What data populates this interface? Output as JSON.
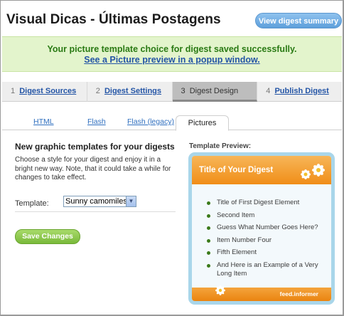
{
  "page": {
    "title": "Visual Dicas - Últimas Postagens",
    "view_digest_button": "View digest summary"
  },
  "banner": {
    "message": "Your picture template choice for digest saved successfully.",
    "link_text": "See a Picture preview in a popup window."
  },
  "steps": [
    {
      "number": "1",
      "label": "Digest Sources"
    },
    {
      "number": "2",
      "label": "Digest Settings"
    },
    {
      "number": "3",
      "label": "Digest Design"
    },
    {
      "number": "4",
      "label": "Publish Digest"
    }
  ],
  "subtabs": [
    {
      "label": "HTML"
    },
    {
      "label": "Flash"
    },
    {
      "label": "Flash (legacy)"
    },
    {
      "label": "Pictures"
    }
  ],
  "main": {
    "heading": "New graphic templates for your digests",
    "description": "Choose a style for your digest and enjoy it in a bright new way. Note, that it could take a while for changes to take effect.",
    "template_label": "Template:",
    "template_value": "Sunny camomiles",
    "save_button": "Save Changes"
  },
  "preview": {
    "heading": "Template Preview:",
    "card_title": "Title of Your Digest",
    "items": [
      "Title of First Digest Element",
      "Second Item",
      "Guess What Number Goes Here?",
      "Item Number Four",
      "Fifth Element",
      "And Here is an Example of a Very Long Item"
    ],
    "footer_brand": "feed.informer"
  },
  "colors": {
    "accent_blue": "#5d9fdb",
    "banner_green": "#2a7a14",
    "save_green": "#79b93a",
    "preview_orange": "#f08e18",
    "preview_border": "#a9d6ea"
  },
  "icons": {
    "select_arrow": "chevron-down-icon",
    "flower": "camomile-icon"
  }
}
